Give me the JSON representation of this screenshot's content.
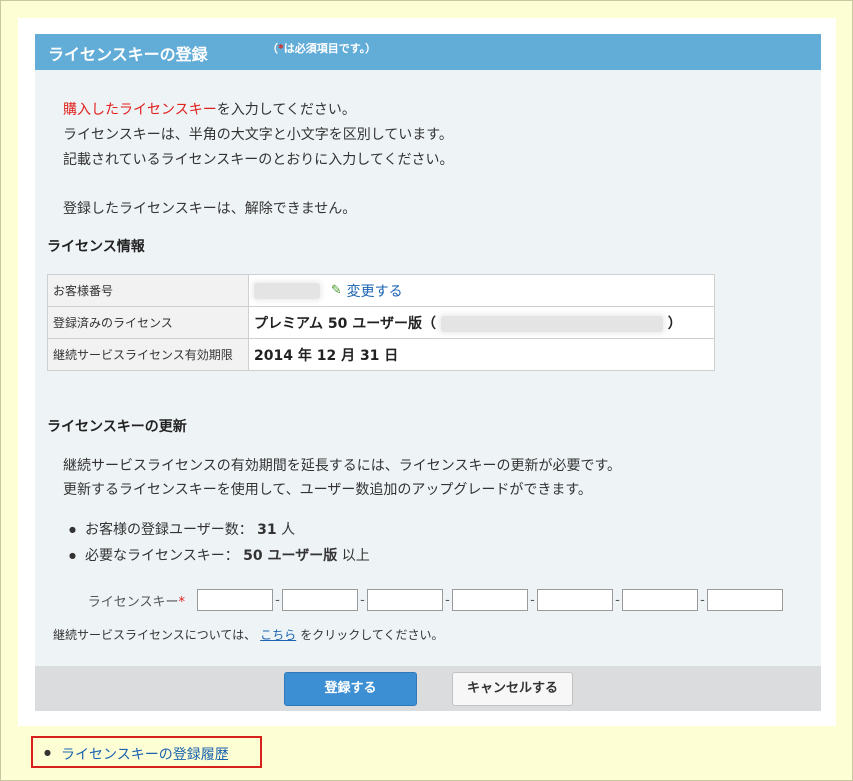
{
  "header": {
    "title": "ライセンスキーの登録",
    "required_prefix": "（",
    "required_star": "*",
    "required_suffix": "は必須項目です。）"
  },
  "intro": {
    "line1_red": "購入したライセンスキー",
    "line1_rest": "を入力してください。",
    "line2": "ライセンスキーは、半角の大文字と小文字を区別しています。",
    "line3": "記載されているライセンスキーのとおりに入力してください。",
    "line4": "登録したライセンスキーは、解除できません。"
  },
  "license_info": {
    "heading": "ライセンス情報",
    "rows": [
      {
        "label": "お客様番号",
        "link": "変更する"
      },
      {
        "label": "登録済みのライセンス",
        "value": "プレミアム  50 ユーザー版（",
        "value_close": "）"
      },
      {
        "label": "継続サービスライセンス有効期限",
        "value": "2014 年 12 月 31 日"
      }
    ]
  },
  "renew": {
    "heading": "ライセンスキーの更新",
    "line1": "継続サービスライセンスの有効期間を延長するには、ライセンスキーの更新が必要です。",
    "line2": "更新するライセンスキーを使用して、ユーザー数追加のアップグレードができます。",
    "bullet1_prefix": "お客様の登録ユーザー数：",
    "bullet1_value": "31",
    "bullet1_suffix": "人",
    "bullet2_prefix": "必要なライセンスキー：",
    "bullet2_value": "50 ユーザー版",
    "bullet2_suffix": "以上"
  },
  "key_input": {
    "label": "ライセンスキー",
    "star": "*",
    "separator": "-"
  },
  "note": {
    "prefix": "継続サービスライセンスについては、",
    "link": "こちら",
    "suffix": "をクリックしてください。"
  },
  "buttons": {
    "register": "登録する",
    "cancel": "キャンセルする"
  },
  "history_link": "ライセンスキーの登録履歴",
  "colors": {
    "header_bg": "#62acd8",
    "required_red": "#e0201c",
    "link_blue": "#1a63b0",
    "primary_button": "#3d8fd4"
  }
}
